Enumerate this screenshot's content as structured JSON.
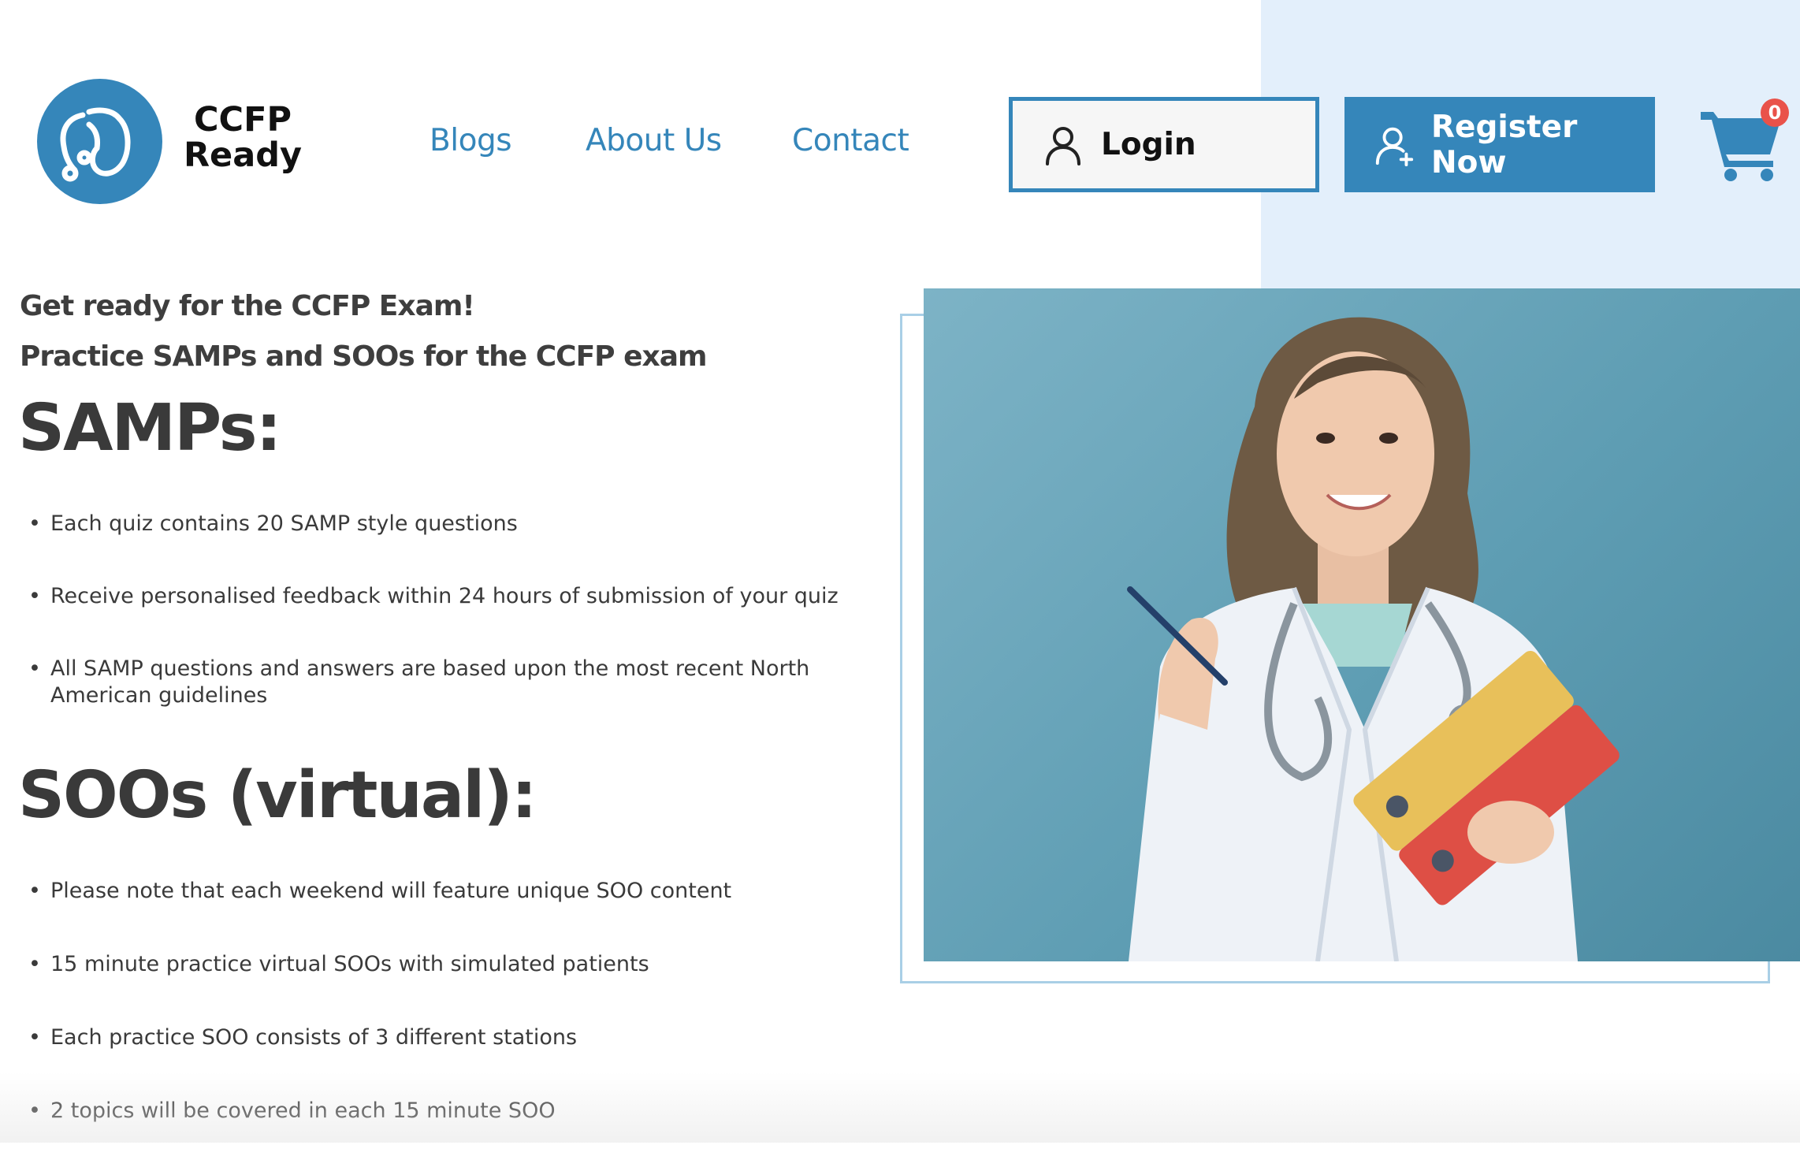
{
  "brand": {
    "line1": "CCFP",
    "line2": "Ready",
    "logo_icon": "stethoscope-icon",
    "accent_color": "#3586ba"
  },
  "nav": {
    "blogs": "Blogs",
    "about": "About Us",
    "contact": "Contact"
  },
  "auth": {
    "login_label": "Login",
    "register_label": "Register Now"
  },
  "cart": {
    "count": "0",
    "icon": "cart-icon",
    "badge_color": "#e9524a"
  },
  "hero": {
    "tagline": "Get ready for the CCFP Exam!",
    "subtitle": "Practice SAMPs and SOOs for the CCFP exam",
    "image_alt": "Smiling doctor in a white coat with a stethoscope, holding a pen and yellow and red binders"
  },
  "samps": {
    "title": "SAMPs:",
    "items": [
      "Each quiz contains 20 SAMP style questions",
      "Receive personalised feedback within 24 hours of submission of your quiz",
      "All SAMP questions and answers are based upon the most recent North American guidelines"
    ]
  },
  "soos": {
    "title": "SOOs (virtual):",
    "items": [
      "Please note that each weekend will feature unique SOO content",
      "15 minute practice virtual SOOs with simulated patients",
      "Each practice SOO consists of 3 different stations",
      "2 topics will be covered in each 15 minute SOO"
    ]
  }
}
